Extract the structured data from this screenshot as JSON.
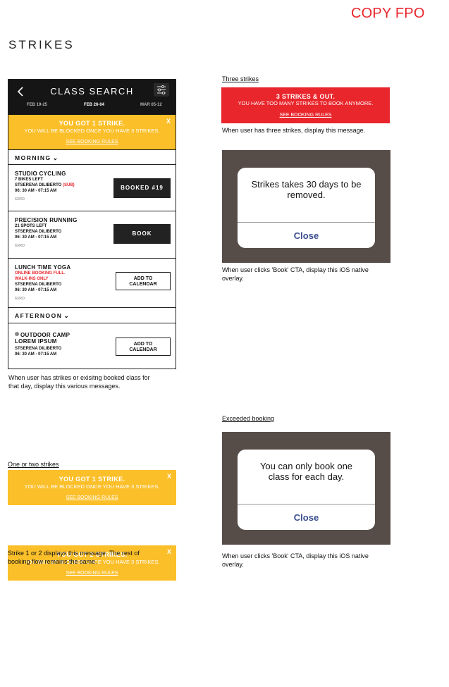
{
  "header": {
    "fpo": "COPY FPO",
    "title": "STRIKES"
  },
  "phone": {
    "title": "CLASS SEARCH",
    "dates": [
      "FEB 19-25",
      "FEB 26-04",
      "MAR 05-12"
    ],
    "banner": {
      "title": "YOU GOT 1 STRIKE.",
      "text": "YOU WILL BE BLOCKED ONCE YOU HAVE 3 STRIKES.",
      "link": "SEE BOOKING RULES",
      "close": "X"
    },
    "sections": {
      "morning": "MORNING",
      "afternoon": "AFTERNOON"
    },
    "classes": [
      {
        "name": "STUDIO CYCLING",
        "line1": "7 BIKES LEFT",
        "instructor": "STSERENA DILIBERTO",
        "sub": "(SUB)",
        "time": "06: 30 AM - 07:15 AM",
        "location": "63RD",
        "button": "BOOKED #19"
      },
      {
        "name": "PRECISION RUNNING",
        "line1": "21 SPOTS LEFT",
        "instructor": "STSERENA DILIBERTO",
        "time": "06: 30 AM - 07:15 AM",
        "location": "63RD",
        "button": "BOOK"
      },
      {
        "name": "LUNCH TIME YOGA",
        "warn1": "ONLINE BOOKING FULL.",
        "warn2": "WALK-INS ONLY",
        "instructor": "STSERENA DILIBERTO",
        "time": "06: 30 AM - 07:15 AM",
        "location": "63RD",
        "button_l1": "ADD TO",
        "button_l2": "CALENDAR"
      },
      {
        "name_l1": "OUTDOOR CAMP",
        "name_l2": "LOREM IPSUM",
        "instructor": "STSERENA DILIBERTO",
        "time": "06: 30 AM - 07:15 AM",
        "button_l1": "ADD TO",
        "button_l2": "CALENDAR"
      }
    ]
  },
  "captions": {
    "phone_l1": "When user has strikes  or exisitng booked class for",
    "phone_l2": "that day, display this various messages.",
    "one_two_label": "One or two strikes",
    "one_two_l1": "Strike 1 or 2 displays this message. The rest of",
    "one_two_l2": "booking flow remains the same.",
    "three_label": "Three strikes",
    "three_caption": "When user has three strikes, display this message.",
    "overlay_l1": "When user clicks 'Book' CTA, display this iOS native",
    "overlay_l2": "overlay.",
    "exceeded_label": "Exceeded booking"
  },
  "strike_banners": [
    {
      "title": "YOU GOT 1 STRIKE.",
      "text": "YOU WILL BE BLOCKED ONCE YOU HAVE 3 STRIKES.",
      "link": "SEE BOOKING RULES",
      "close": "X"
    },
    {
      "title": "YOU GOT 2 STRIKES.",
      "text": "YOU WILL BE BLOCKED ONCE YOU HAVE 3 STRIKES.",
      "link": "SEE BOOKING RULES",
      "close": "X"
    }
  ],
  "three_strikes": {
    "title": "3 STRIKES & OUT.",
    "text": "YOU HAVE TOO MANY STRIKES TO BOOK ANYMORE.",
    "link": "SEE BOOKING RULES"
  },
  "dialogs": [
    {
      "msg_l1": "Strikes takes 30 days to be",
      "msg_l2": "removed.",
      "button": "Close"
    },
    {
      "msg_l1": "You can only book one",
      "msg_l2": "class for each day.",
      "button": "Close"
    }
  ],
  "colors": {
    "yellow": "#fbbf2a",
    "red": "#e8262c",
    "dark": "#151515",
    "ios_bg": "#564d49",
    "ios_blue": "#3a4d8f"
  }
}
